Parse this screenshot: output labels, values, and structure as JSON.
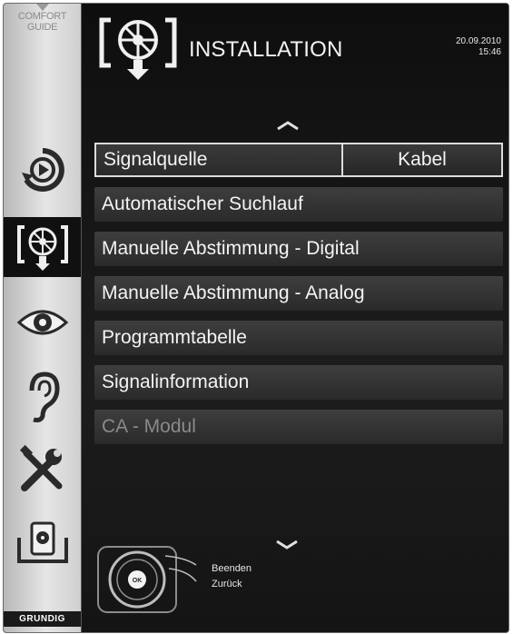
{
  "sidebar": {
    "comfort_guide_line1": "COMFORT",
    "comfort_guide_line2": "GUIDE",
    "items": [
      {
        "icon": "play-circle-icon"
      },
      {
        "icon": "installation-icon",
        "active": true
      },
      {
        "icon": "eye-icon"
      },
      {
        "icon": "ear-icon"
      },
      {
        "icon": "tools-icon"
      },
      {
        "icon": "media-icon"
      }
    ],
    "brand": "GRUNDIG"
  },
  "header": {
    "title": "INSTALLATION",
    "date": "20.09.2010",
    "time": "15:46"
  },
  "menu": {
    "signal_source_label": "Signalquelle",
    "signal_source_value": "Kabel",
    "items": [
      "Automatischer Suchlauf",
      "Manuelle Abstimmung - Digital",
      "Manuelle Abstimmung - Analog",
      "Programmtabelle",
      "Signalinformation",
      "CA - Modul"
    ]
  },
  "legend": {
    "ok_label": "OK",
    "exit": "Beenden",
    "back": "Zurück"
  },
  "colors": {
    "background": "#161616",
    "row": "#333333",
    "sidebar": "#d6d6d6",
    "text": "#f4f4f4",
    "disabled_text": "#8a8a8a"
  }
}
